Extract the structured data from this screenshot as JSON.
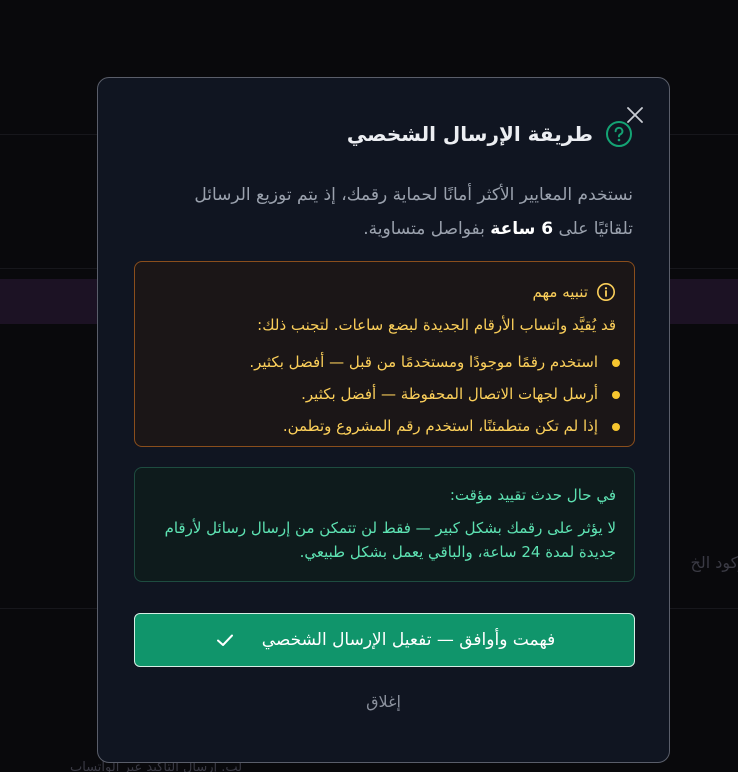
{
  "background": {
    "right_snippet": "ركود الخ",
    "bottom_snippet": "لب. إرسال التأكيد عبر الواتساب"
  },
  "modal": {
    "title": "طريقة الإرسال الشخصي",
    "help_icon": "question-circle-icon",
    "close_icon": "close-icon",
    "description_before": "نستخدم المعايير الأكثر أمانًا لحماية رقمك، إذ يتم توزيع الرسائل تلقائيًا على ",
    "description_strong": "6 ساعة",
    "description_after": " بفواصل متساوية.",
    "warning": {
      "icon": "info-circle-icon",
      "title": "تنبيه مهم",
      "lead": "قد يُقيَّد واتساب الأرقام الجديدة لبضع ساعات. لتجنب ذلك:",
      "items": [
        "استخدم رقمًا موجودًا ومستخدمًا من قبل — أفضل بكثير.",
        "أرسل لجهات الاتصال المحفوظة — أفضل بكثير.",
        "إذا لم تكن متطمئنًا، استخدم رقم المشروع وتطمن."
      ]
    },
    "info": {
      "title": "في حال حدث تقييد مؤقت:",
      "body": "لا يؤثر على رقمك بشكل كبير — فقط لن تتمكن من إرسال رسائل لأرقام جديدة لمدة 24 ساعة، والباقي يعمل بشكل طبيعي."
    },
    "confirm_label": "فهمت وأوافق — تفعيل الإرسال الشخصي",
    "confirm_icon": "check-icon",
    "dismiss_label": "إغلاق"
  },
  "colors": {
    "overlay": "#09090c",
    "modal_bg": "#101521",
    "accent_green": "#10956b",
    "warning_text": "#fbcf5a",
    "info_text": "#5de2b2"
  }
}
